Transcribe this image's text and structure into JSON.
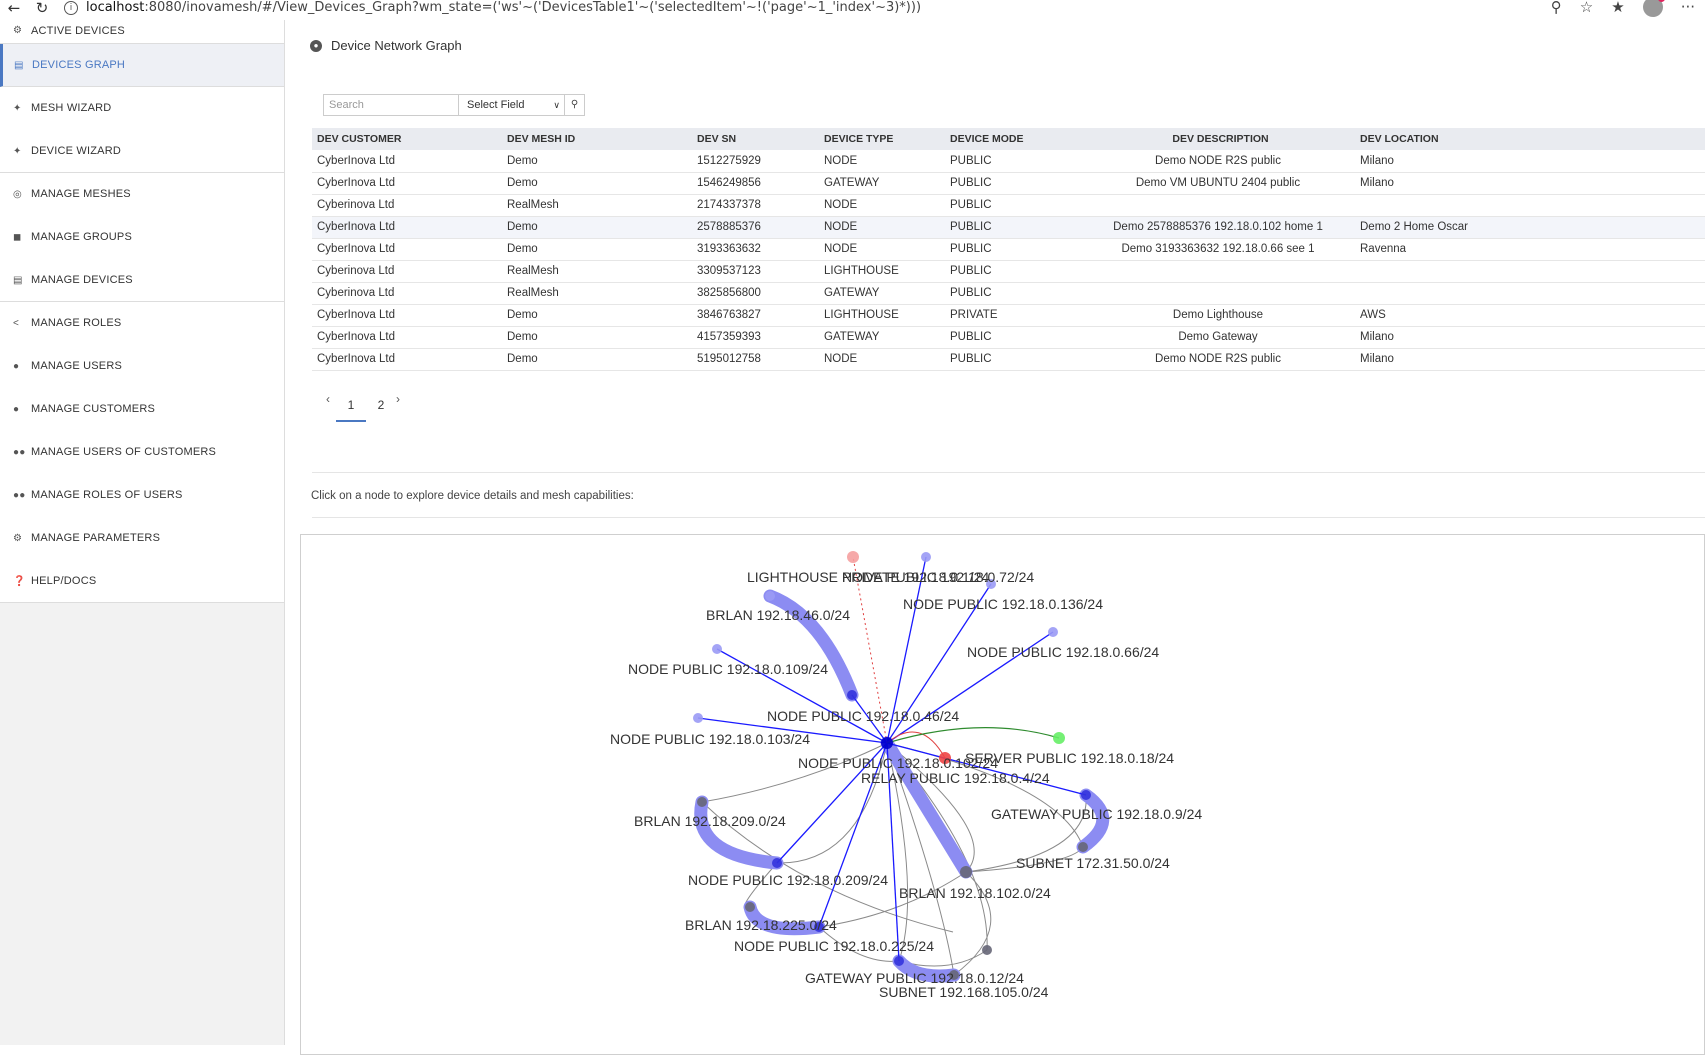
{
  "browser": {
    "url_host": "localhost",
    "url_rest": ":8080/inovamesh/#/View_Devices_Graph?wm_state=('ws'~('DevicesTable1'~('selectedItem'~!('page'~1_'index'~3)*)))"
  },
  "sidebar": {
    "items": [
      {
        "label": "ACTIVE DEVICES",
        "icon": "active-devices-icon"
      },
      {
        "label": "DEVICES GRAPH",
        "icon": "devices-graph-icon"
      },
      {
        "label": "MESH WIZARD",
        "icon": "wand-icon"
      },
      {
        "label": "DEVICE WIZARD",
        "icon": "wand-icon"
      },
      {
        "label": "MANAGE MESHES",
        "icon": "globe-icon"
      },
      {
        "label": "MANAGE GROUPS",
        "icon": "lock-icon"
      },
      {
        "label": "MANAGE DEVICES",
        "icon": "database-icon"
      },
      {
        "label": "MANAGE ROLES",
        "icon": "share-icon"
      },
      {
        "label": "MANAGE USERS",
        "icon": "user-icon"
      },
      {
        "label": "MANAGE CUSTOMERS",
        "icon": "user-icon"
      },
      {
        "label": "MANAGE USERS OF CUSTOMERS",
        "icon": "users-icon"
      },
      {
        "label": "MANAGE ROLES OF USERS",
        "icon": "users-icon"
      },
      {
        "label": "MANAGE PARAMETERS",
        "icon": "gear-icon"
      },
      {
        "label": "HELP/DOCS",
        "icon": "help-icon"
      }
    ]
  },
  "main": {
    "title": "Device Network Graph",
    "search_placeholder": "Search",
    "select_field": "Select Field",
    "hint": "Click on a node to explore device details and mesh capabilities:"
  },
  "table": {
    "columns": [
      "DEV CUSTOMER",
      "DEV MESH ID",
      "DEV SN",
      "DEVICE TYPE",
      "DEVICE MODE",
      "DEV DESCRIPTION",
      "DEV LOCATION"
    ],
    "rows": [
      [
        "CyberInova Ltd",
        "Demo",
        "1512275929",
        "NODE",
        "PUBLIC",
        "Demo NODE R2S public",
        "Milano"
      ],
      [
        "CyberInova Ltd",
        "Demo",
        "1546249856",
        "GATEWAY",
        "PUBLIC",
        "Demo VM UBUNTU 2404 public",
        "Milano"
      ],
      [
        "Cyberinova Ltd",
        "RealMesh",
        "2174337378",
        "NODE",
        "PUBLIC",
        "",
        ""
      ],
      [
        "CyberInova Ltd",
        "Demo",
        "2578885376",
        "NODE",
        "PUBLIC",
        "Demo 2578885376 192.18.0.102 home 1",
        "Demo 2 Home Oscar"
      ],
      [
        "CyberInova Ltd",
        "Demo",
        "3193363632",
        "NODE",
        "PUBLIC",
        "Demo 3193363632 192.18.0.66 see 1",
        "Ravenna"
      ],
      [
        "Cyberinova Ltd",
        "RealMesh",
        "3309537123",
        "LIGHTHOUSE",
        "PUBLIC",
        "",
        ""
      ],
      [
        "Cyberinova Ltd",
        "RealMesh",
        "3825856800",
        "GATEWAY",
        "PUBLIC",
        "",
        ""
      ],
      [
        "CyberInova Ltd",
        "Demo",
        "3846763827",
        "LIGHTHOUSE",
        "PRIVATE",
        "Demo Lighthouse",
        "AWS"
      ],
      [
        "CyberInova Ltd",
        "Demo",
        "4157359393",
        "GATEWAY",
        "PUBLIC",
        "Demo Gateway",
        "Milano"
      ],
      [
        "CyberInova Ltd",
        "Demo",
        "5195012758",
        "NODE",
        "PUBLIC",
        "Demo NODE R2S public",
        "Milano"
      ]
    ],
    "highlighted_row": 3
  },
  "pager": {
    "pages": [
      "1",
      "2"
    ],
    "active": "1"
  },
  "graph": {
    "labels": [
      "LIGHTHOUSE PRIVATE 192.18.0.1/24",
      "NODE PUBLIC 192.18.0.72/24",
      "NODE PUBLIC 192.18.0.136/24",
      "BRLAN 192.18.46.0/24",
      "NODE PUBLIC 192.18.0.66/24",
      "NODE PUBLIC 192.18.0.109/24",
      "NODE PUBLIC 192.18.0.46/24",
      "NODE PUBLIC 192.18.0.103/24",
      "NODE PUBLIC 192.18.0.102/24",
      "SERVER PUBLIC 192.18.0.18/24",
      "RELAY PUBLIC 192.18.0.4/24",
      "GATEWAY PUBLIC 192.18.0.9/24",
      "BRLAN 192.18.209.0/24",
      "SUBNET 172.31.50.0/24",
      "NODE PUBLIC 192.18.0.209/24",
      "BRLAN 192.18.102.0/24",
      "BRLAN 192.18.225.0/24",
      "NODE PUBLIC 192.18.0.225/24",
      "GATEWAY PUBLIC 192.18.0.12/24",
      "SUBNET 192.168.105.0/24"
    ],
    "colors": {
      "edge_blue": "#1a1aff",
      "edge_thick": "#8c8cf2",
      "edge_gray": "#8a8a8a",
      "edge_green": "#2e8b2e",
      "edge_red": "#e04040",
      "node_blue": "#3333dd",
      "node_light": "#9a9af5",
      "node_pink": "#f5a0a0",
      "node_red": "#ee4444",
      "node_green": "#66ee66",
      "node_gray": "#666677"
    }
  }
}
